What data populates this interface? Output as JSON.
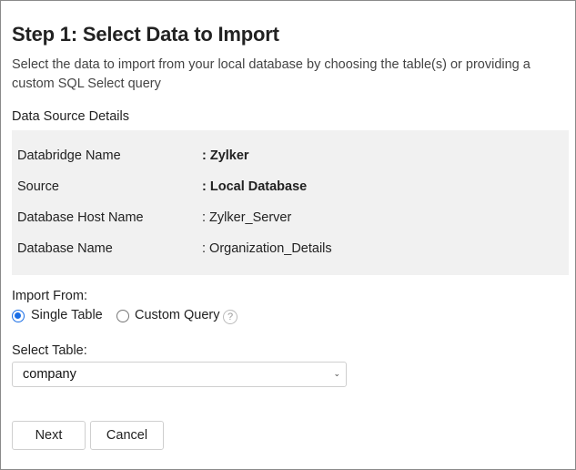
{
  "header": {
    "title": "Step 1: Select Data to Import",
    "description": "Select the data to import from your local database by choosing the table(s) or providing a custom SQL Select query"
  },
  "details": {
    "section_label": "Data Source Details",
    "rows": [
      {
        "key": "Databridge Name",
        "value": ": Zylker",
        "bold": true
      },
      {
        "key": "Source",
        "value": ": Local Database",
        "bold": true
      },
      {
        "key": "Database Host Name",
        "value": ": Zylker_Server",
        "bold": false
      },
      {
        "key": "Database Name",
        "value": ": Organization_Details",
        "bold": false
      }
    ]
  },
  "import_from": {
    "label": "Import From:",
    "options": [
      {
        "label": "Single Table",
        "selected": true
      },
      {
        "label": "Custom Query",
        "selected": false
      }
    ],
    "help_glyph": "?"
  },
  "select_table": {
    "label": "Select Table:",
    "value": "company",
    "chevron": "⌄"
  },
  "actions": {
    "next_label": "Next",
    "cancel_label": "Cancel"
  },
  "colors": {
    "accent": "#1a6ee6",
    "panel_bg": "#f1f1f1"
  }
}
